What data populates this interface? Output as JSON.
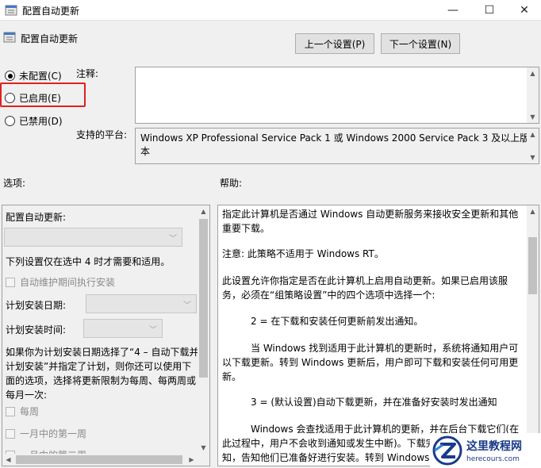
{
  "window": {
    "title": "配置自动更新",
    "min_glyph": "—",
    "max_glyph": "☐",
    "close_glyph": "✕"
  },
  "header": {
    "title": "配置自动更新",
    "prev_button": "上一个设置(P)",
    "next_button": "下一个设置(N)"
  },
  "state": {
    "options": [
      {
        "label": "未配置(C)",
        "checked": true
      },
      {
        "label": "已启用(E)",
        "checked": false
      },
      {
        "label": "已禁用(D)",
        "checked": false
      }
    ]
  },
  "labels": {
    "comment": "注释:",
    "platform": "支持的平台:",
    "options": "选项:",
    "help": "帮助:"
  },
  "platform_text": "Windows XP Professional Service Pack 1 或 Windows 2000 Service Pack 3 及以上版本",
  "options_panel": {
    "configure_label": "配置自动更新:",
    "note_text": "下列设置仅在选中 4 时才需要和适用。",
    "maintenance_checkbox": "自动维护期间执行安装",
    "schedule_day_label": "计划安装日期:",
    "schedule_time_label": "计划安装时间:",
    "weekly_text": "如果你为计划安装日期选择了“4 – 自动下载并计划安装”并指定了计划，则你还可以使用下面的选项，选择将更新限制为每周、每两周或每月一次:",
    "weekly_checkbox": "每周",
    "first_week_checkbox": "一月中的第一周",
    "second_week_checkbox": "一月中的第二周"
  },
  "help_panel": {
    "paragraphs": [
      "指定此计算机是否通过 Windows 自动更新服务来接收安全更新和其他重要下载。",
      "注意: 此策略不适用于 Windows RT。",
      "此设置允许你指定是否在此计算机上启用自动更新。如果已启用该服务，必须在“组策略设置”中的四个选项中选择一个:",
      "2 = 在下载和安装任何更新前发出通知。",
      "当 Windows 找到适用于此计算机的更新时，系统将通知用户可以下载更新。转到 Windows 更新后，用户即可下载和安装任何可用更新。",
      "3 = (默认设置)自动下载更新，并在准备好安装时发出通知",
      "Windows 会查找适用于此计算机的更新，并在后台下载它们(在此过程中，用户不会收到通知或发生中断)。下载完成后，用户将收到通知，告知他们已准备好进行安装。转到 Windows 更新后，"
    ]
  },
  "watermark": {
    "cn": "这里教程网",
    "en": "herecours.com"
  },
  "colors": {
    "highlight_border": "#e02020",
    "watermark_blue": "#1a3a8a"
  }
}
